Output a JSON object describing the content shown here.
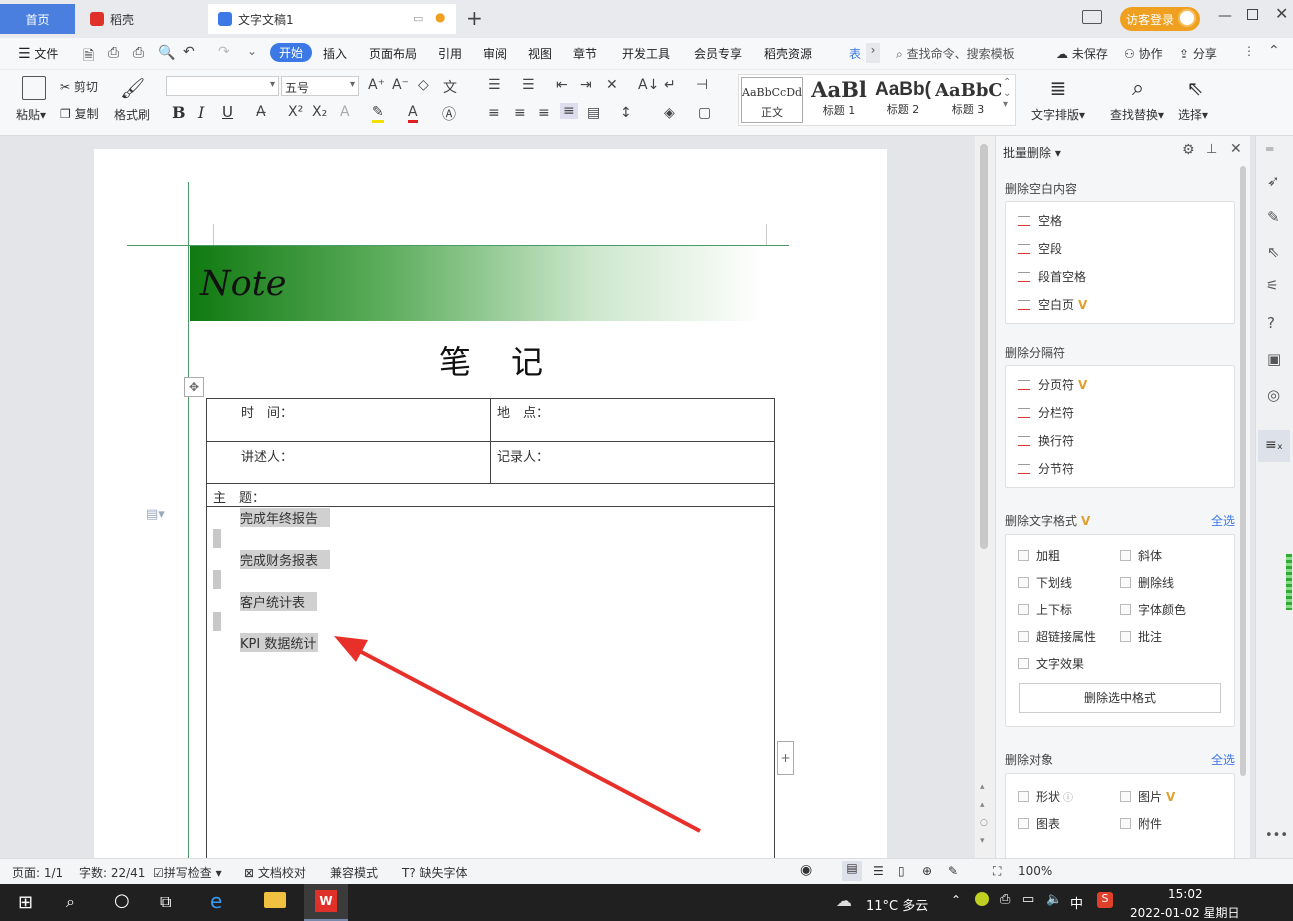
{
  "tabs": {
    "home": "首页",
    "daoke": "稻壳",
    "doc": "文字文稿1",
    "guest_login": "访客登录"
  },
  "menu": {
    "file": "文件",
    "items": [
      "开始",
      "插入",
      "页面布局",
      "引用",
      "审阅",
      "视图",
      "章节",
      "开发工具",
      "会员专享",
      "稻壳资源",
      "表"
    ],
    "search_placeholder": "查找命令、搜索模板",
    "unsaved": "未保存",
    "collab": "协作",
    "share": "分享"
  },
  "toolbar": {
    "paste": "粘贴",
    "cut": "剪切",
    "copy": "复制",
    "format_painter": "格式刷",
    "font_size": "五号",
    "bold": "B",
    "italic": "I",
    "underline": "U",
    "styles": [
      {
        "preview": "AaBbCcDd",
        "name": "正文"
      },
      {
        "preview": "AaBl",
        "name": "标题 1"
      },
      {
        "preview": "AaBb(",
        "name": "标题 2"
      },
      {
        "preview": "AaBbC",
        "name": "标题 3"
      }
    ],
    "text_layout": "文字排版",
    "find_replace": "查找替换",
    "select": "选择"
  },
  "document": {
    "banner": "Note",
    "title": "笔　记",
    "time_label": "时　间：",
    "place_label": "地　点：",
    "speaker_label": "讲述人：",
    "recorder_label": "记录人：",
    "topic_label": "主　题：",
    "lines": [
      "完成年终报告",
      "完成财务报表",
      "客户统计表",
      "KPI 数据统计"
    ]
  },
  "panel": {
    "title": "批量删除",
    "sec1": "删除空白内容",
    "sec1_items": [
      "空格",
      "空段",
      "段首空格",
      "空白页"
    ],
    "sec2": "删除分隔符",
    "sec2_items": [
      "分页符",
      "分栏符",
      "换行符",
      "分节符"
    ],
    "sec3": "删除文字格式",
    "select_all": "全选",
    "sec3_items": [
      "加粗",
      "斜体",
      "下划线",
      "删除线",
      "上下标",
      "字体颜色",
      "超链接属性",
      "批注",
      "文字效果"
    ],
    "delete_selected": "删除选中格式",
    "sec4": "删除对象",
    "select_all2": "全选",
    "sec4_items": [
      "形状",
      "图片",
      "图表",
      "附件"
    ]
  },
  "status": {
    "page": "页面: 1/1",
    "words": "字数: 22/41",
    "spell": "拼写检查",
    "proof": "文档校对",
    "compat": "兼容模式",
    "missing_font": "缺失字体",
    "zoom": "100%"
  },
  "taskbar": {
    "weather": "11°C  多云",
    "ime": "中",
    "time": "15:02",
    "date": "2022-01-02 星期日"
  },
  "colors": {
    "accent": "#3c78e6",
    "banner_green": "#1a7a1a",
    "arrow_red": "#e8302a",
    "guest_orange": "#f0a020"
  }
}
